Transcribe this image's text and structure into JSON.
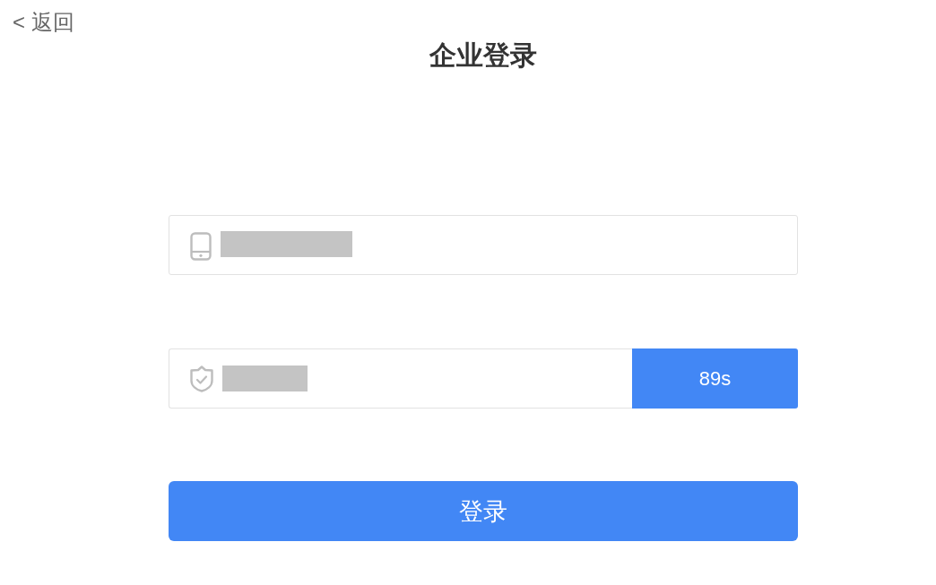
{
  "back_link": {
    "label": "< 返回"
  },
  "title": "企业登录",
  "fields": [
    {
      "kind": "phone",
      "value_redacted": true
    },
    {
      "kind": "code",
      "value_redacted": true,
      "button": "89s"
    }
  ],
  "login_button": "登录"
}
